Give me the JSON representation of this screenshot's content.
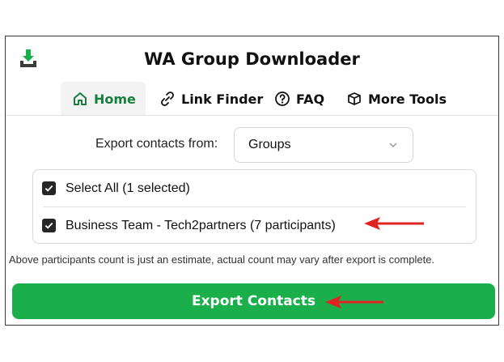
{
  "app": {
    "title": "WA Group Downloader",
    "icon": "download-icon",
    "accent_color": "#1aaf4b",
    "active_tab_color": "#15803d"
  },
  "tabs": [
    {
      "label": "Home",
      "icon": "home-icon",
      "active": true
    },
    {
      "label": "Link Finder",
      "icon": "link-icon",
      "active": false
    },
    {
      "label": "FAQ",
      "icon": "help-circle-icon",
      "active": false
    },
    {
      "label": "More Tools",
      "icon": "box-icon",
      "active": false
    }
  ],
  "export_from": {
    "label": "Export contacts from:",
    "selected": "Groups"
  },
  "list": {
    "select_all_label": "Select All (1 selected)",
    "select_all_checked": true,
    "items": [
      {
        "label": "Business Team - Tech2partners (7 participants)",
        "checked": true
      }
    ]
  },
  "note": "Above participants count is just an estimate, actual count may vary after export is complete.",
  "export_button": {
    "label": "Export Contacts"
  },
  "annotations": {
    "arrow_color": "#e02424"
  }
}
